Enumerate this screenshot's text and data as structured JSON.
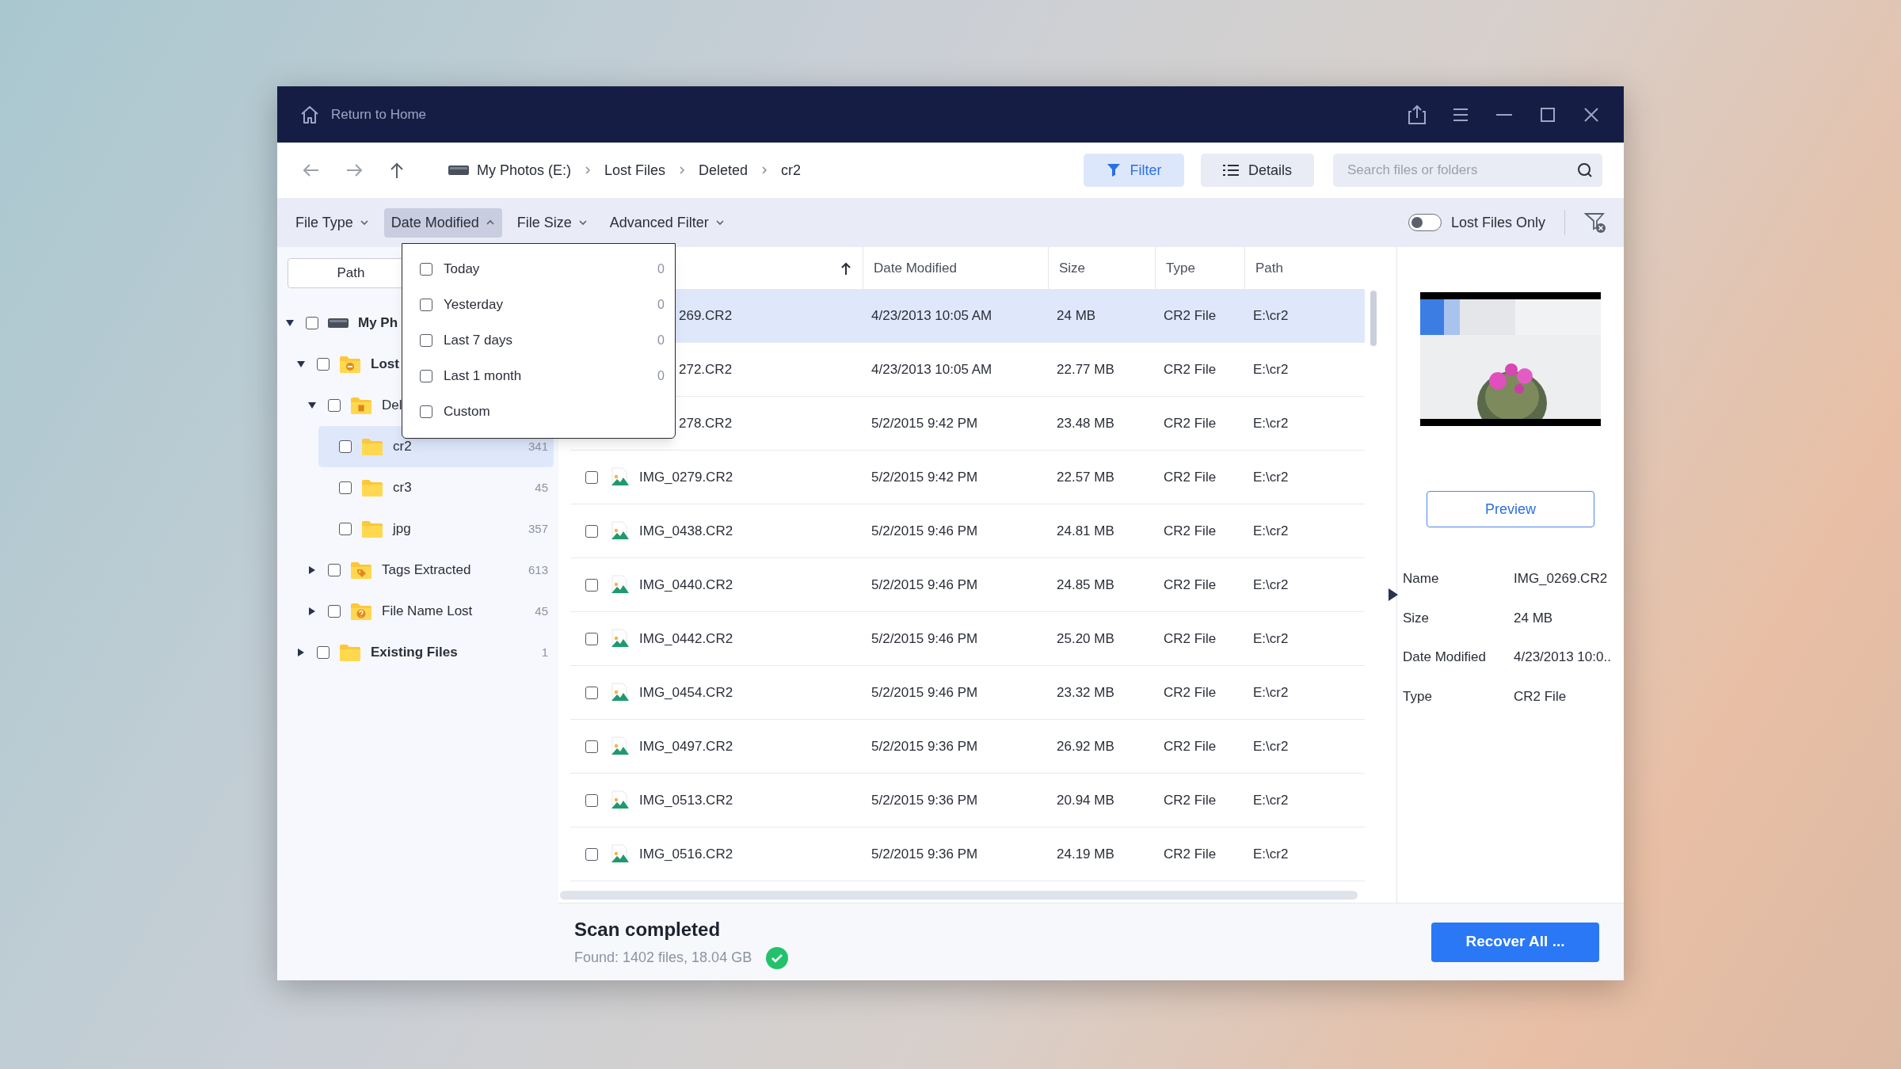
{
  "title_bar": {
    "home_label": "Return to Home"
  },
  "nav": {
    "breadcrumb": [
      "My Photos (E:)",
      "Lost Files",
      "Deleted",
      "cr2"
    ],
    "view_buttons": [
      {
        "kind": "filter",
        "label": "Filter",
        "selected": true
      },
      {
        "kind": "details",
        "label": "Details",
        "selected": false
      }
    ],
    "search": {
      "placeholder": "Search files or folders"
    }
  },
  "filters": [
    {
      "label": "File Type",
      "expanded": false
    },
    {
      "label": "Date Modified",
      "expanded": true
    },
    {
      "label": "File Size",
      "expanded": false
    },
    {
      "label": "Advanced Filter",
      "expanded": false
    }
  ],
  "lost_files_only": {
    "label": "Lost Files Only",
    "on": false
  },
  "date_menu": [
    {
      "label": "Today",
      "count": "0",
      "checked": false
    },
    {
      "label": "Yesterday",
      "count": "0",
      "checked": false
    },
    {
      "label": "Last 7 days",
      "count": "0",
      "checked": false
    },
    {
      "label": "Last 1 month",
      "count": "0",
      "checked": false
    },
    {
      "label": "Custom",
      "checked": false
    }
  ],
  "sidebar": {
    "path_button": "Path",
    "tree": [
      {
        "label": "My Ph",
        "kind": "drive",
        "checked": false,
        "expanded": true,
        "selected": false,
        "children": [
          {
            "label": "Lost",
            "kind": "lost",
            "checked": false,
            "expanded": true,
            "selected": false,
            "children": [
              {
                "label": "Del",
                "kind": "deleted",
                "checked": false,
                "expanded": true,
                "selected": false,
                "children": [
                  {
                    "label": "cr2",
                    "kind": "folder",
                    "count": "341",
                    "checked": false,
                    "selected": true
                  },
                  {
                    "label": "cr3",
                    "kind": "folder",
                    "count": "45",
                    "checked": false,
                    "selected": false
                  },
                  {
                    "label": "jpg",
                    "kind": "folder",
                    "count": "357",
                    "checked": false,
                    "selected": false
                  }
                ]
              },
              {
                "label": "Tags Extracted",
                "kind": "tags",
                "count": "613",
                "checked": false,
                "expanded": false,
                "selected": false
              },
              {
                "label": "File Name Lost",
                "kind": "unknown",
                "count": "45",
                "checked": false,
                "expanded": false,
                "selected": false
              }
            ]
          },
          {
            "label": "Existing Files",
            "kind": "folder",
            "count": "1",
            "checked": false,
            "expanded": false,
            "selected": false
          }
        ]
      }
    ]
  },
  "table": {
    "columns": [
      "Date Modified",
      "Size",
      "Type",
      "Path"
    ],
    "rows": [
      {
        "name": "269.CR2",
        "kind": "partial",
        "selected": true,
        "date": "4/23/2013 10:05 AM",
        "size": "24 MB",
        "type": "CR2 File",
        "path": "E:\\cr2"
      },
      {
        "name": "272.CR2",
        "kind": "partial",
        "selected": false,
        "date": "4/23/2013 10:05 AM",
        "size": "22.77 MB",
        "type": "CR2 File",
        "path": "E:\\cr2"
      },
      {
        "name": "278.CR2",
        "kind": "partial",
        "selected": false,
        "date": "5/2/2015 9:42 PM",
        "size": "23.48 MB",
        "type": "CR2 File",
        "path": "E:\\cr2"
      },
      {
        "name": "IMG_0279.CR2",
        "kind": "file",
        "checked": false,
        "selected": false,
        "date": "5/2/2015 9:42 PM",
        "size": "22.57 MB",
        "type": "CR2 File",
        "path": "E:\\cr2"
      },
      {
        "name": "IMG_0438.CR2",
        "kind": "file",
        "checked": false,
        "selected": false,
        "date": "5/2/2015 9:46 PM",
        "size": "24.81 MB",
        "type": "CR2 File",
        "path": "E:\\cr2"
      },
      {
        "name": "IMG_0440.CR2",
        "kind": "file",
        "checked": false,
        "selected": false,
        "date": "5/2/2015 9:46 PM",
        "size": "24.85 MB",
        "type": "CR2 File",
        "path": "E:\\cr2"
      },
      {
        "name": "IMG_0442.CR2",
        "kind": "file",
        "checked": false,
        "selected": false,
        "date": "5/2/2015 9:46 PM",
        "size": "25.20 MB",
        "type": "CR2 File",
        "path": "E:\\cr2"
      },
      {
        "name": "IMG_0454.CR2",
        "kind": "file",
        "checked": false,
        "selected": false,
        "date": "5/2/2015 9:46 PM",
        "size": "23.32 MB",
        "type": "CR2 File",
        "path": "E:\\cr2"
      },
      {
        "name": "IMG_0497.CR2",
        "kind": "file",
        "checked": false,
        "selected": false,
        "date": "5/2/2015 9:36 PM",
        "size": "26.92 MB",
        "type": "CR2 File",
        "path": "E:\\cr2"
      },
      {
        "name": "IMG_0513.CR2",
        "kind": "file",
        "checked": false,
        "selected": false,
        "date": "5/2/2015 9:36 PM",
        "size": "20.94 MB",
        "type": "CR2 File",
        "path": "E:\\cr2"
      },
      {
        "name": "IMG_0516.CR2",
        "kind": "file",
        "checked": false,
        "selected": false,
        "date": "5/2/2015 9:36 PM",
        "size": "24.19 MB",
        "type": "CR2 File",
        "path": "E:\\cr2"
      }
    ]
  },
  "details": {
    "preview_button": "Preview",
    "fields": [
      {
        "label": "Name",
        "value": "IMG_0269.CR2"
      },
      {
        "label": "Size",
        "value": "24 MB"
      },
      {
        "label": "Date Modified",
        "value": "4/23/2013 10:0.."
      },
      {
        "label": "Type",
        "value": "CR2 File"
      }
    ]
  },
  "status": {
    "title": "Scan completed",
    "summary": "Found: 1402 files, 18.04 GB",
    "recover_button": "Recover All ..."
  }
}
